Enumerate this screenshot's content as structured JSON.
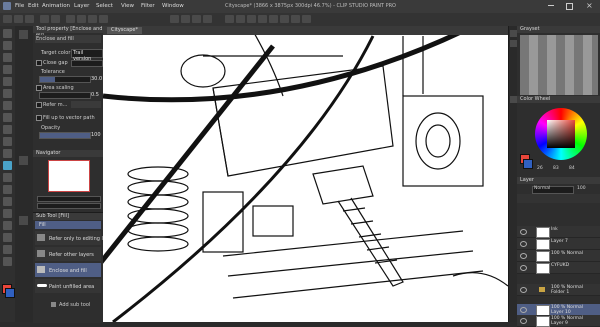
{
  "window": {
    "title": "Cityscape* (3866 x 3875px 300dpi 46.7%) - CLIP STUDIO PAINT PRO"
  },
  "menu": [
    "File",
    "Edit",
    "Animation",
    "Layer",
    "Select",
    "View",
    "Filter",
    "Window"
  ],
  "tool_property": {
    "header": "Tool property [Enclose and fill]",
    "subtool_name": "Enclose and fill",
    "target_color_label": "Target color",
    "target_color_value": "Trail version",
    "close_gap_label": "Close gap",
    "tolerance_label": "Tolerance",
    "tolerance_value": "30.0",
    "area_scaling_label": "Area scaling",
    "area_scaling_value": "0.5",
    "refer_label": "Refer m...",
    "fill_vector_label": "Fill up to vector path",
    "opacity_label": "Opacity",
    "opacity_value": "100"
  },
  "navigator": {
    "header": "Navigator"
  },
  "sub_tool": {
    "header": "Sub Tool [Fill]",
    "items": [
      {
        "label": "Fill"
      },
      {
        "label": "Refer only to editing layer"
      },
      {
        "label": "Refer other layers"
      },
      {
        "label": "Enclose and fill"
      },
      {
        "label": "Paint unfilled area"
      }
    ],
    "add_label": "Add sub tool"
  },
  "canvas": {
    "tab_label": "Cityscape*"
  },
  "color_wheel": {
    "header": "Color Wheel",
    "values": [
      "26",
      "83",
      "84"
    ]
  },
  "color_set": {
    "header": "Grayset"
  },
  "layers": {
    "header": "Layer",
    "blend": "Normal",
    "opacity": "100",
    "items": [
      {
        "name": "Ink",
        "meta": ""
      },
      {
        "name": "Layer 7",
        "meta": ""
      },
      {
        "name": "CYFUKD",
        "meta": "100 % Normal"
      },
      {
        "name": "Folder 1",
        "meta": "100 % Normal"
      },
      {
        "name": "Layer 10",
        "meta": "100 % Normal"
      },
      {
        "name": "Layer 9",
        "meta": "100 % Normal"
      }
    ]
  },
  "colors": {
    "accent": "#4f5e85",
    "ui_bg": "#2e2e2e",
    "main_color": "#e8463a"
  }
}
